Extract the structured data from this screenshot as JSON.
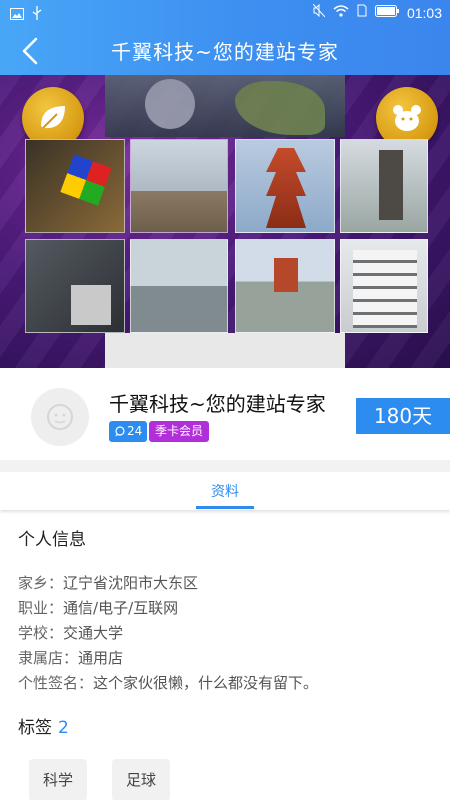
{
  "status_bar": {
    "time": "01:03",
    "battery_icon": "battery-icon",
    "wifi_icon": "wifi-icon",
    "mute_icon": "mute-icon"
  },
  "header": {
    "title": "千翼科技~您的建站专家"
  },
  "profile": {
    "name": "千翼科技~您的建站专家",
    "comment_count": "24",
    "membership": "季卡会员",
    "days": "180天"
  },
  "tabs": [
    {
      "label": "资料",
      "active": true
    }
  ],
  "info": {
    "section_title": "个人信息",
    "rows": [
      {
        "label": "家乡：",
        "value": "辽宁省沈阳市大东区"
      },
      {
        "label": "职业：",
        "value": "通信/电子/互联网"
      },
      {
        "label": "学校：",
        "value": "交通大学"
      },
      {
        "label": "隶属店：",
        "value": "通用店"
      },
      {
        "label": "个性签名：",
        "value": "这个家伙很懒，什么都没有留下。"
      }
    ]
  },
  "tags": {
    "title": "标签",
    "count": "2",
    "items": [
      "科学",
      "足球"
    ]
  },
  "colors": {
    "accent": "#2d8cf0",
    "membership": "#b12fd8",
    "header_start": "#48a6f7",
    "header_end": "#3b86ee"
  }
}
